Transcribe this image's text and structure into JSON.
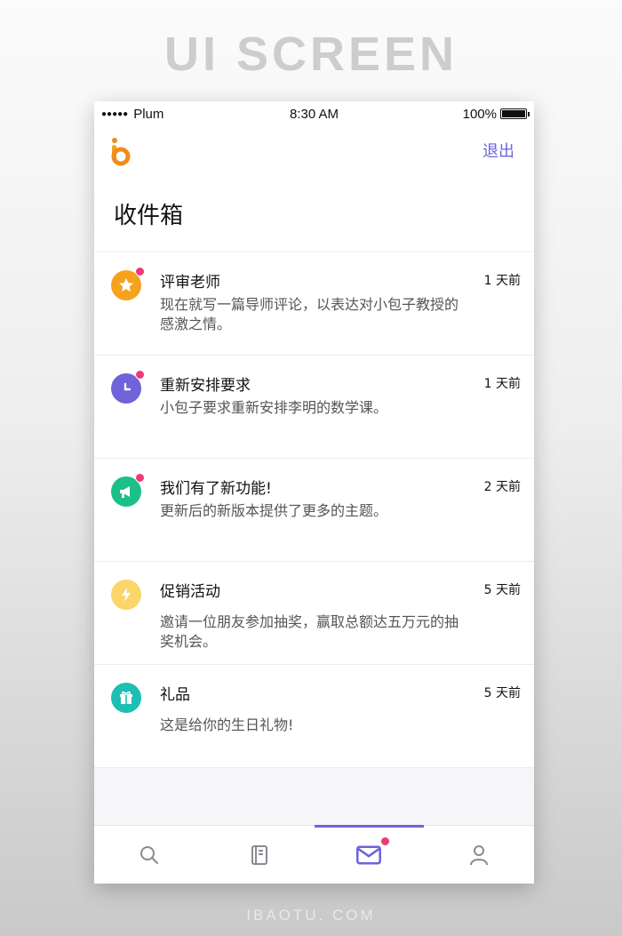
{
  "header_caption": "UI SCREEN",
  "status_bar": {
    "carrier": "Plum",
    "time": "8:30 AM",
    "battery": "100%",
    "battery_level": 1.0
  },
  "app": {
    "logout_label": "退出",
    "title": "收件箱"
  },
  "messages": [
    {
      "title": "评审老师",
      "time": "1 天前",
      "body": "现在就写一篇导师评论，以表达对小包子教授的感激之情。",
      "icon": "star-icon",
      "color": "#f6a21e",
      "unread": true
    },
    {
      "title": "重新安排要求",
      "time": "1 天前",
      "body": "小包子要求重新安排李明的数学课。",
      "icon": "clock-icon",
      "color": "#6e63d9",
      "unread": true
    },
    {
      "title": "我们有了新功能!",
      "time": "2 天前",
      "body": "更新后的新版本提供了更多的主题。",
      "icon": "megaphone-icon",
      "color": "#1cbf8a",
      "unread": true
    },
    {
      "title": "促销活动",
      "time": "5 天前",
      "body": "邀请一位朋友参加抽奖，赢取总额达五万元的抽奖机会。",
      "icon": "lightning-icon",
      "color": "#f9d56a",
      "unread": false
    },
    {
      "title": "礼品",
      "time": "5 天前",
      "body": "这是给你的生日礼物!",
      "icon": "gift-icon",
      "color": "#1dbfb3",
      "unread": false
    }
  ],
  "tabs": [
    {
      "name": "search-icon",
      "active": false
    },
    {
      "name": "book-icon",
      "active": false
    },
    {
      "name": "mail-icon",
      "active": true,
      "badge": true
    },
    {
      "name": "user-icon",
      "active": false
    }
  ],
  "accent_color": "#6e63d9",
  "badge_color": "#ef3a75",
  "footer_watermark": "IBAOTU. COM"
}
